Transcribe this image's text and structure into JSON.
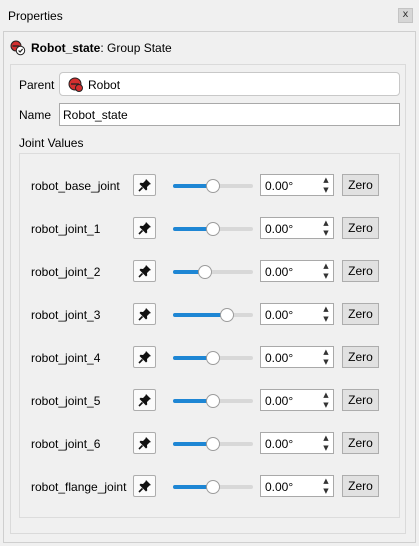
{
  "window": {
    "title": "Properties",
    "close_icon": "close-icon",
    "close_glyph": "x"
  },
  "header": {
    "name": "Robot_state",
    "type": ": Group State"
  },
  "form": {
    "parent_label": "Parent",
    "parent_value": "Robot",
    "name_label": "Name",
    "name_value": "Robot_state",
    "joint_values_label": "Joint Values"
  },
  "joints": [
    {
      "name": "robot_base_joint",
      "value": "0.00°",
      "slider_fraction": 0.5,
      "zero_label": "Zero"
    },
    {
      "name": "robot_joint_1",
      "value": "0.00°",
      "slider_fraction": 0.5,
      "zero_label": "Zero"
    },
    {
      "name": "robot_joint_2",
      "value": "0.00°",
      "slider_fraction": 0.4,
      "zero_label": "Zero"
    },
    {
      "name": "robot_joint_3",
      "value": "0.00°",
      "slider_fraction": 0.67,
      "zero_label": "Zero"
    },
    {
      "name": "robot_joint_4",
      "value": "0.00°",
      "slider_fraction": 0.5,
      "zero_label": "Zero"
    },
    {
      "name": "robot_joint_5",
      "value": "0.00°",
      "slider_fraction": 0.5,
      "zero_label": "Zero"
    },
    {
      "name": "robot_joint_6",
      "value": "0.00°",
      "slider_fraction": 0.5,
      "zero_label": "Zero"
    },
    {
      "name": "robot_flange_joint",
      "value": "0.00°",
      "slider_fraction": 0.5,
      "zero_label": "Zero"
    }
  ],
  "spin": {
    "up_glyph": "▲",
    "down_glyph": "▼"
  },
  "colors": {
    "accent": "#1e86d4",
    "robot_icon_red": "#d32f2f"
  }
}
